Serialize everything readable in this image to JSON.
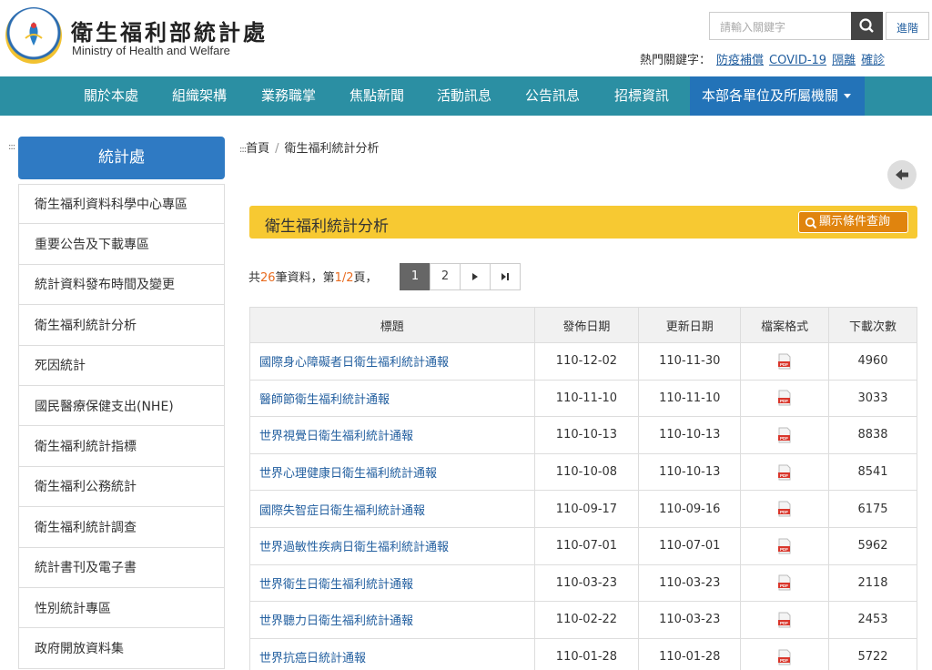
{
  "header": {
    "title": "衛生福利部統計處",
    "subtitle": "Ministry of Health and Welfare",
    "search_placeholder": "請輸入關鍵字",
    "advanced_label": "進階",
    "hot_keywords_label": "熱門關鍵字：",
    "hot_keywords": [
      "防疫補償",
      "COVID-19",
      "隔離",
      "確診"
    ]
  },
  "nav": {
    "items": [
      "關於本處",
      "組織架構",
      "業務職掌",
      "焦點新聞",
      "活動訊息",
      "公告訊息",
      "招標資訊"
    ],
    "special": "本部各單位及所屬機關"
  },
  "sidebar": {
    "head": "統計處",
    "items": [
      "衛生福利資料科學中心專區",
      "重要公告及下載專區",
      "統計資料發布時間及變更",
      "衛生福利統計分析",
      "死因統計",
      "國民醫療保健支出(NHE)",
      "衛生福利統計指標",
      "衛生福利公務統計",
      "衛生福利統計調查",
      "統計書刊及電子書",
      "性別統計專區",
      "政府開放資料集"
    ]
  },
  "breadcrumb": {
    "home": "首頁",
    "current": "衛生福利統計分析"
  },
  "page": {
    "title": "衛生福利統計分析",
    "query_button": "顯示條件查詢"
  },
  "summary": {
    "prefix": "共",
    "total": "26",
    "mid": "筆資料，第",
    "page": "1/2",
    "suffix": "頁，"
  },
  "pager": {
    "pages": [
      "1",
      "2"
    ],
    "current": "1"
  },
  "table": {
    "headers": [
      "標題",
      "發佈日期",
      "更新日期",
      "檔案格式",
      "下載次數"
    ],
    "rows": [
      {
        "title": "國際身心障礙者日衛生福利統計通報",
        "published": "110-12-02",
        "updated": "110-11-30",
        "format": "PDF",
        "downloads": "4960"
      },
      {
        "title": "醫師節衛生福利統計通報",
        "published": "110-11-10",
        "updated": "110-11-10",
        "format": "PDF",
        "downloads": "3033"
      },
      {
        "title": "世界視覺日衛生福利統計通報",
        "published": "110-10-13",
        "updated": "110-10-13",
        "format": "PDF",
        "downloads": "8838"
      },
      {
        "title": "世界心理健康日衛生福利統計通報",
        "published": "110-10-08",
        "updated": "110-10-13",
        "format": "PDF",
        "downloads": "8541"
      },
      {
        "title": "國際失智症日衛生福利統計通報",
        "published": "110-09-17",
        "updated": "110-09-16",
        "format": "PDF",
        "downloads": "6175"
      },
      {
        "title": "世界過敏性疾病日衛生福利統計通報",
        "published": "110-07-01",
        "updated": "110-07-01",
        "format": "PDF",
        "downloads": "5962"
      },
      {
        "title": "世界衛生日衛生福利統計通報",
        "published": "110-03-23",
        "updated": "110-03-23",
        "format": "PDF",
        "downloads": "2118"
      },
      {
        "title": "世界聽力日衛生福利統計通報",
        "published": "110-02-22",
        "updated": "110-03-23",
        "format": "PDF",
        "downloads": "2453"
      },
      {
        "title": "世界抗癌日統計通報",
        "published": "110-01-28",
        "updated": "110-01-28",
        "format": "PDF",
        "downloads": "5722"
      }
    ]
  },
  "colors": {
    "nav": "#2b8fa3",
    "nav_special": "#2373b8",
    "sidebar_head": "#2f7ac3",
    "title_bar": "#f7c932",
    "query_button": "#e0840e",
    "link": "#2460a0",
    "count": "#e86b1f"
  }
}
